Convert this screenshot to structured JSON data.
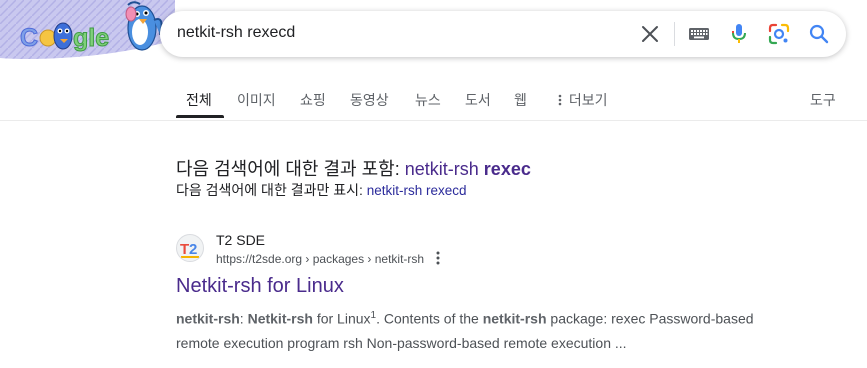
{
  "search": {
    "query": "netkit-rsh rexecd"
  },
  "header": {
    "logo_alt": "Google"
  },
  "tabs": [
    {
      "label": "전체",
      "active": true
    },
    {
      "label": "이미지"
    },
    {
      "label": "쇼핑"
    },
    {
      "label": "동영상"
    },
    {
      "label": "뉴스"
    },
    {
      "label": "도서"
    },
    {
      "label": "웹"
    },
    {
      "label": "더보기"
    },
    {
      "label": "도구"
    }
  ],
  "correction": {
    "prefix": "다음 검색어에 대한 결과 포함:",
    "term_plain": "netkit-rsh",
    "term_bold": "rexec",
    "only_prefix": "다음 검색어에 대한 결과만 표시:",
    "only_term": "netkit-rsh rexecd"
  },
  "result": {
    "site_name": "T2 SDE",
    "url": "https://t2sde.org › packages › netkit-rsh",
    "title": "Netkit-rsh for Linux",
    "snippet": {
      "b1": "netkit-rsh",
      "t1": ": ",
      "b2": "Netkit-rsh",
      "t2": " for Linux",
      "sup": "1",
      "t3": ". Contents of the ",
      "b3": "netkit-rsh",
      "t4": " package: rexec Password-based remote execution program rsh Non-password-based remote execution ..."
    }
  },
  "colors": {
    "visited_link": "#4a2b8c",
    "google_blue": "#4285f4",
    "google_red": "#ea4335",
    "google_yellow": "#fbbc05",
    "google_green": "#34a853"
  }
}
